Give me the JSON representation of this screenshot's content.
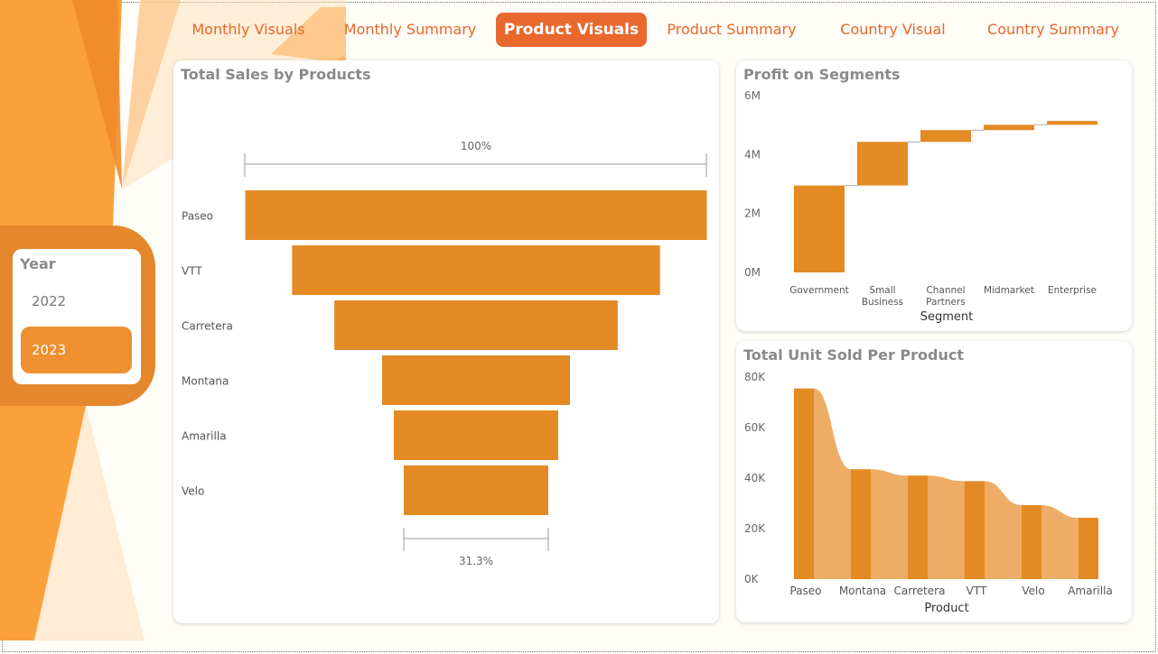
{
  "tabs": [
    {
      "label": "Monthly Visuals",
      "active": false
    },
    {
      "label": "Monthly Summary",
      "active": false
    },
    {
      "label": "Product Visuals",
      "active": true
    },
    {
      "label": "Product Summary",
      "active": false
    },
    {
      "label": "Country Visual",
      "active": false
    },
    {
      "label": "Country Summary",
      "active": false
    }
  ],
  "slicer": {
    "title": "Year",
    "items": [
      {
        "label": "2022",
        "selected": false
      },
      {
        "label": "2023",
        "selected": true
      }
    ]
  },
  "colors": {
    "accent": "#e38a24",
    "accent_light": "#eead66",
    "tab_active": "#e8682e",
    "tab_text": "#e8672a",
    "title_gray": "#8a8a8a"
  },
  "chart_data": [
    {
      "id": "funnel",
      "type": "bar",
      "subtype": "funnel",
      "title": "Total Sales by Products",
      "categories": [
        "Paseo",
        "VTT",
        "Carretera",
        "Montana",
        "Amarilla",
        "Velo"
      ],
      "values": [
        100,
        79.7,
        61.4,
        40.7,
        35.6,
        31.3
      ],
      "value_unit": "% of first",
      "top_label": "100%",
      "bottom_label": "31.3%"
    },
    {
      "id": "waterfall",
      "type": "bar",
      "subtype": "waterfall",
      "title": "Profit on Segments",
      "xlabel": "Segment",
      "categories": [
        "Government",
        "Small Business",
        "Channel Partners",
        "Midmarket",
        "Enterprise"
      ],
      "values": [
        2950000,
        1480000,
        400000,
        180000,
        130000
      ],
      "yticks": [
        "0M",
        "2M",
        "4M",
        "6M"
      ],
      "ylim": [
        0,
        6000000
      ]
    },
    {
      "id": "ribbon",
      "type": "bar",
      "subtype": "ribbon",
      "title": "Total Unit Sold Per Product",
      "xlabel": "Product",
      "categories": [
        "Paseo",
        "Montana",
        "Carretera",
        "VTT",
        "Velo",
        "Amarilla"
      ],
      "values": [
        75500,
        43500,
        41000,
        38800,
        29300,
        24300
      ],
      "yticks": [
        "0K",
        "20K",
        "40K",
        "60K",
        "80K"
      ],
      "ylim": [
        0,
        80000
      ]
    }
  ]
}
